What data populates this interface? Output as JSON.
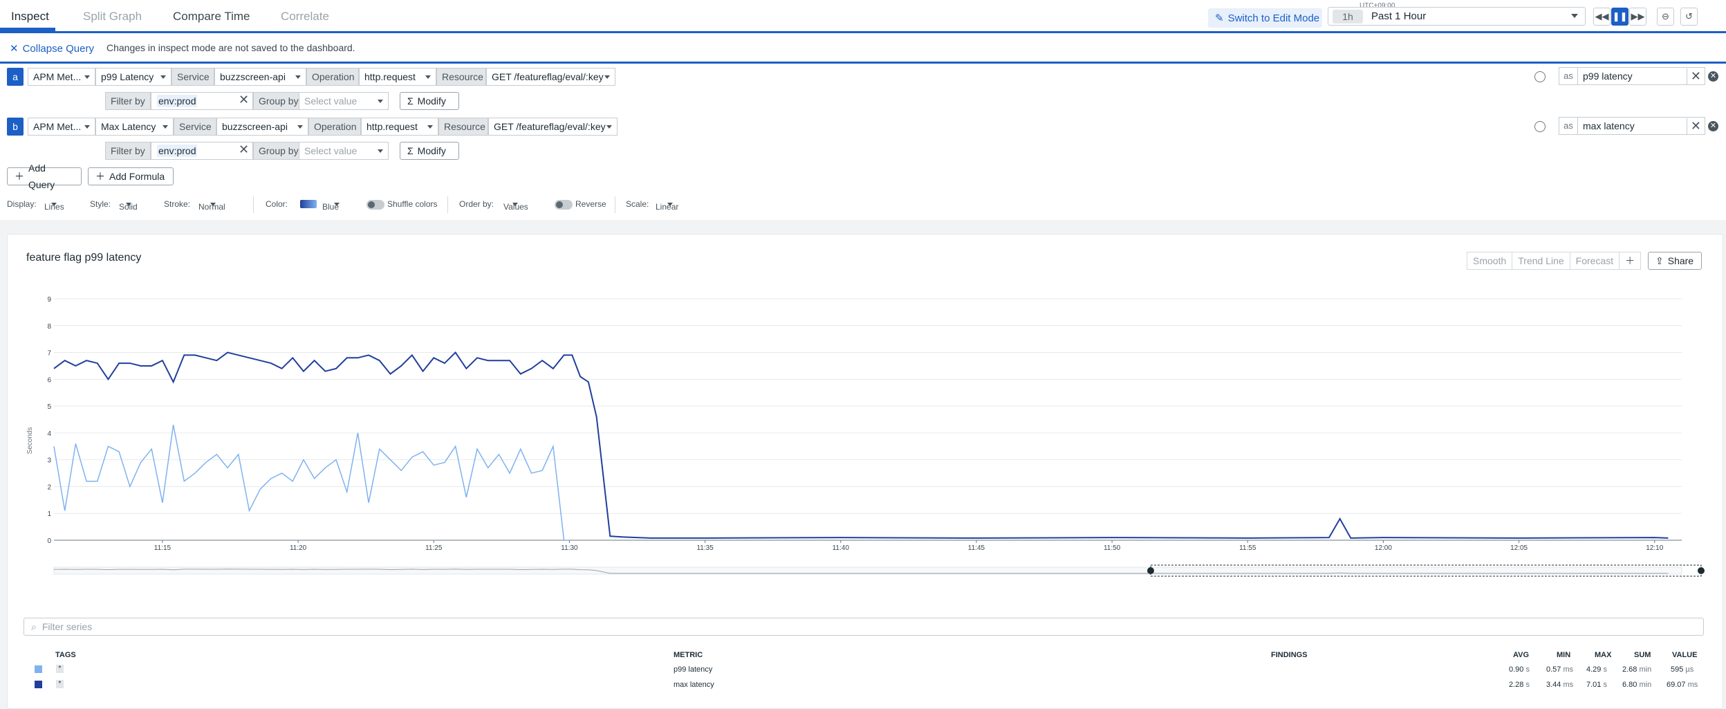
{
  "tabs": [
    {
      "label": "Inspect"
    },
    {
      "label": "Split Graph"
    },
    {
      "label": "Compare Time"
    },
    {
      "label": "Correlate"
    }
  ],
  "header": {
    "edit_label": "Switch to Edit Mode",
    "tz": "UTC+09:00",
    "range_short": "1h",
    "range_label": "Past 1 Hour"
  },
  "collapse_label": "Collapse Query",
  "notice": "Changes in inspect mode are not saved to the dashboard.",
  "queries": [
    {
      "letter": "a",
      "source": "APM Met...",
      "metric": "p99 Latency",
      "service_label": "Service",
      "service": "buzzscreen-api",
      "operation_label": "Operation",
      "operation": "http.request",
      "resource_label": "Resource",
      "resource": "GET /featureflag/eval/:key",
      "filter_label": "Filter by",
      "filter": "env:prod",
      "group_label": "Group by",
      "group_placeholder": "Select value",
      "modify": "Modify",
      "as_label": "as",
      "alias": "p99 latency"
    },
    {
      "letter": "b",
      "source": "APM Met...",
      "metric": "Max Latency",
      "service_label": "Service",
      "service": "buzzscreen-api",
      "operation_label": "Operation",
      "operation": "http.request",
      "resource_label": "Resource",
      "resource": "GET /featureflag/eval/:key",
      "filter_label": "Filter by",
      "filter": "env:prod",
      "group_label": "Group by",
      "group_placeholder": "Select value",
      "modify": "Modify",
      "as_label": "as",
      "alias": "max latency"
    }
  ],
  "actions": {
    "add_query": "Add Query",
    "add_formula": "Add Formula"
  },
  "display": {
    "display_label": "Display:",
    "display": "Lines",
    "style_label": "Style:",
    "style": "Solid",
    "stroke_label": "Stroke:",
    "stroke": "Normal",
    "color_label": "Color:",
    "color": "Blue",
    "shuffle": "Shuffle colors",
    "order_label": "Order by:",
    "order": "Values",
    "reverse": "Reverse",
    "scale_label": "Scale:",
    "scale": "Linear"
  },
  "graph": {
    "title": "feature flag p99 latency",
    "buttons": [
      "Smooth",
      "Trend Line",
      "Forecast"
    ],
    "share": "Share"
  },
  "filter_placeholder": "Filter series",
  "legend_table": {
    "headers": {
      "tags": "TAGS",
      "metric": "METRIC",
      "findings": "FINDINGS",
      "avg": "AVG",
      "min": "MIN",
      "max": "MAX",
      "sum": "SUM",
      "value": "VALUE"
    },
    "rows": [
      {
        "tag": "*",
        "metric": "p99 latency",
        "avg": "0.90",
        "avg_u": "s",
        "min": "0.57",
        "min_u": "ms",
        "max": "4.29",
        "max_u": "s",
        "sum": "2.68",
        "sum_u": "min",
        "value": "595",
        "value_u": "µs",
        "color": "#7fb2ef"
      },
      {
        "tag": "*",
        "metric": "max latency",
        "avg": "2.28",
        "avg_u": "s",
        "min": "3.44",
        "min_u": "ms",
        "max": "7.01",
        "max_u": "s",
        "sum": "6.80",
        "sum_u": "min",
        "value": "69.07",
        "value_u": "ms",
        "color": "#1f3f9c"
      }
    ]
  },
  "chart_data": {
    "type": "line",
    "ylabel": "Seconds",
    "ylim": [
      0,
      9
    ],
    "yticks": [
      0,
      1,
      2,
      3,
      4,
      5,
      6,
      7,
      8,
      9
    ],
    "xticks": [
      "11:15",
      "11:20",
      "11:25",
      "11:30",
      "11:35",
      "11:40",
      "11:45",
      "11:50",
      "11:55",
      "12:00",
      "12:05",
      "12:10"
    ],
    "xtick_minutes": [
      15,
      20,
      25,
      30,
      35,
      40,
      45,
      50,
      55,
      60,
      65,
      70
    ],
    "xlim_minutes": [
      11.0,
      71.0
    ],
    "series": [
      {
        "name": "p99 latency",
        "color": "#7fb2ef",
        "x": [
          11.0,
          11.4,
          11.8,
          12.2,
          12.6,
          13.0,
          13.4,
          13.8,
          14.2,
          14.6,
          15.0,
          15.4,
          15.8,
          16.2,
          16.6,
          17.0,
          17.4,
          17.8,
          18.2,
          18.6,
          19.0,
          19.4,
          19.8,
          20.2,
          20.6,
          21.0,
          21.4,
          21.8,
          22.2,
          22.6,
          23.0,
          23.4,
          23.8,
          24.2,
          24.6,
          25.0,
          25.4,
          25.8,
          26.2,
          26.6,
          27.0,
          27.4,
          27.8,
          28.2,
          28.6,
          29.0,
          29.4,
          29.8,
          30.0
        ],
        "values": [
          3.5,
          1.1,
          3.6,
          2.2,
          2.2,
          3.5,
          3.3,
          2.0,
          2.9,
          3.4,
          1.4,
          4.3,
          2.2,
          2.5,
          2.9,
          3.2,
          2.7,
          3.2,
          1.1,
          1.9,
          2.3,
          2.5,
          2.2,
          3.0,
          2.3,
          2.7,
          3.0,
          1.8,
          4.0,
          1.4,
          3.4,
          3.0,
          2.6,
          3.1,
          3.3,
          2.8,
          2.9,
          3.5,
          1.6,
          3.4,
          2.7,
          3.2,
          2.5,
          3.4,
          2.5,
          2.6,
          3.5,
          0.0,
          0.0
        ]
      },
      {
        "name": "max latency",
        "color": "#1f3f9c",
        "x": [
          11.0,
          11.4,
          11.8,
          12.2,
          12.6,
          13.0,
          13.4,
          13.8,
          14.2,
          14.6,
          15.0,
          15.4,
          15.8,
          16.2,
          16.6,
          17.0,
          17.4,
          17.8,
          18.2,
          18.6,
          19.0,
          19.4,
          19.8,
          20.2,
          20.6,
          21.0,
          21.4,
          21.8,
          22.2,
          22.6,
          23.0,
          23.4,
          23.8,
          24.2,
          24.6,
          25.0,
          25.4,
          25.8,
          26.2,
          26.6,
          27.0,
          27.4,
          27.8,
          28.2,
          28.6,
          29.0,
          29.4,
          29.8,
          30.1,
          30.4,
          30.7,
          31.0,
          31.5,
          32.0,
          33.0,
          35.0,
          40.0,
          45.0,
          50.0,
          55.0,
          58.0,
          58.4,
          58.8,
          60.0,
          65.0,
          70.0,
          70.5
        ],
        "values": [
          6.4,
          6.7,
          6.5,
          6.7,
          6.6,
          6.0,
          6.6,
          6.6,
          6.5,
          6.5,
          6.7,
          5.9,
          6.9,
          6.9,
          6.8,
          6.7,
          7.0,
          6.9,
          6.8,
          6.7,
          6.6,
          6.4,
          6.8,
          6.3,
          6.7,
          6.3,
          6.4,
          6.8,
          6.8,
          6.9,
          6.7,
          6.2,
          6.5,
          6.9,
          6.3,
          6.8,
          6.6,
          7.0,
          6.4,
          6.8,
          6.7,
          6.7,
          6.7,
          6.2,
          6.4,
          6.7,
          6.4,
          6.9,
          6.9,
          6.1,
          5.9,
          4.6,
          0.15,
          0.12,
          0.08,
          0.08,
          0.1,
          0.08,
          0.1,
          0.08,
          0.1,
          0.8,
          0.08,
          0.1,
          0.08,
          0.1,
          0.08
        ]
      }
    ]
  }
}
